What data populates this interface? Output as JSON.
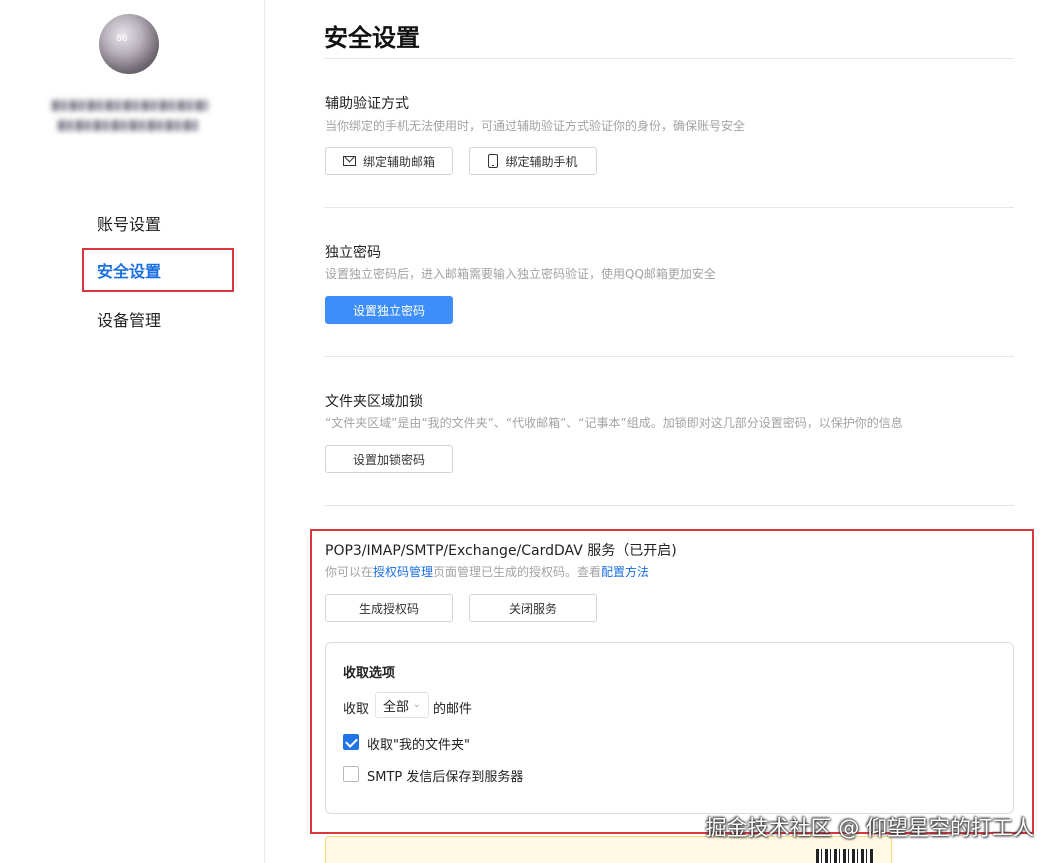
{
  "user": {
    "avatar_text": "86"
  },
  "sidebar": {
    "items": [
      {
        "label": "账号设置"
      },
      {
        "label": "安全设置"
      },
      {
        "label": "设备管理"
      }
    ]
  },
  "page": {
    "title": "安全设置"
  },
  "sections": {
    "assist": {
      "title": "辅助验证方式",
      "desc": "当你绑定的手机无法使用时，可通过辅助验证方式验证你的身份，确保账号安全",
      "email_button": "绑定辅助邮箱",
      "phone_button": "绑定辅助手机"
    },
    "password": {
      "title": "独立密码",
      "desc": "设置独立密码后，进入邮箱需要输入独立密码验证，使用QQ邮箱更加安全",
      "button": "设置独立密码"
    },
    "folder_lock": {
      "title": "文件夹区域加锁",
      "desc": "“文件夹区域”是由“我的文件夹”、“代收邮箱”、“记事本”组成。加锁即对这几部分设置密码，以保护你的信息",
      "button": "设置加锁密码"
    },
    "service": {
      "title": "POP3/IMAP/SMTP/Exchange/CardDAV 服务（已开启)",
      "desc_prefix": "你可以在",
      "desc_link1": "授权码管理",
      "desc_middle": "页面管理已生成的授权码。查看",
      "desc_link2": "配置方法",
      "generate_button": "生成授权码",
      "close_button": "关闭服务"
    },
    "receive": {
      "title": "收取选项",
      "prefix": "收取",
      "select_value": "全部",
      "suffix": "的邮件",
      "option1_label": "收取\"我的文件夹\"",
      "option1_checked": true,
      "option2_label": "SMTP 发信后保存到服务器",
      "option2_checked": false
    }
  },
  "watermark": "掘金技术社区 @ 仰望星空的打工人",
  "colors": {
    "accent": "#1a6fe3",
    "primary_button": "#3d8ef8",
    "highlight_border": "#d9363e",
    "notice_bg": "#fff9e3"
  }
}
